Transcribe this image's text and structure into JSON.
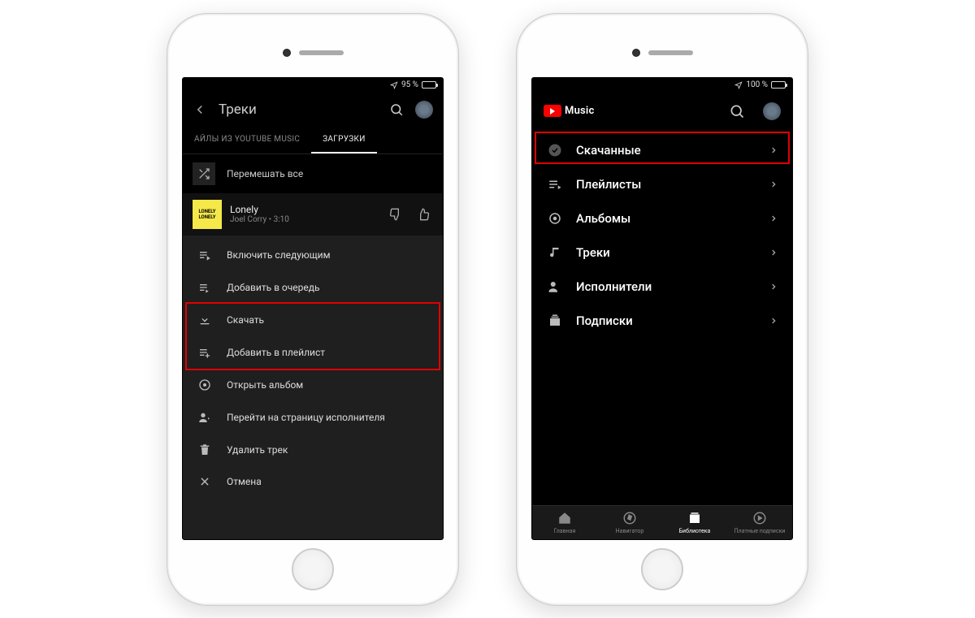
{
  "phone1": {
    "status": {
      "battery_text": "95 %",
      "battery_pct": 95
    },
    "header": {
      "title": "Треки"
    },
    "tabs": {
      "left": "АЙЛЫ ИЗ YOUTUBE MUSIC",
      "right": "ЗАГРУЗКИ"
    },
    "shuffle_label": "Перемешать все",
    "track": {
      "title": "Lonely",
      "subtitle": "Joel Corry • 3:10",
      "art_text_top": "LONELY",
      "art_text_bottom": "LONELY"
    },
    "menu": [
      {
        "icon": "play-next",
        "label": "Включить следующим",
        "highlight": false
      },
      {
        "icon": "queue",
        "label": "Добавить в очередь",
        "highlight": false
      },
      {
        "icon": "download",
        "label": "Скачать",
        "highlight": true
      },
      {
        "icon": "playlist-add",
        "label": "Добавить в плейлист",
        "highlight": true
      },
      {
        "icon": "album",
        "label": "Открыть альбом",
        "highlight": false
      },
      {
        "icon": "artist",
        "label": "Перейти на страницу исполнителя",
        "highlight": false
      },
      {
        "icon": "trash",
        "label": "Удалить трек",
        "highlight": false
      },
      {
        "icon": "close",
        "label": "Отмена",
        "highlight": false
      }
    ]
  },
  "phone2": {
    "status": {
      "battery_text": "100 %",
      "battery_pct": 100
    },
    "header": {
      "brand": "Music"
    },
    "library": [
      {
        "icon": "downloaded",
        "label": "Скачанные",
        "highlight": true
      },
      {
        "icon": "playlists",
        "label": "Плейлисты",
        "highlight": false
      },
      {
        "icon": "albums",
        "label": "Альбомы",
        "highlight": false
      },
      {
        "icon": "tracks",
        "label": "Треки",
        "highlight": false
      },
      {
        "icon": "artists",
        "label": "Исполнители",
        "highlight": false
      },
      {
        "icon": "subscriptions",
        "label": "Подписки",
        "highlight": false
      }
    ],
    "nav": [
      {
        "icon": "home",
        "label": "Главная",
        "active": false
      },
      {
        "icon": "explore",
        "label": "Навигатор",
        "active": false
      },
      {
        "icon": "library",
        "label": "Библиотека",
        "active": true
      },
      {
        "icon": "paid",
        "label": "Платные подписки",
        "active": false
      }
    ]
  }
}
